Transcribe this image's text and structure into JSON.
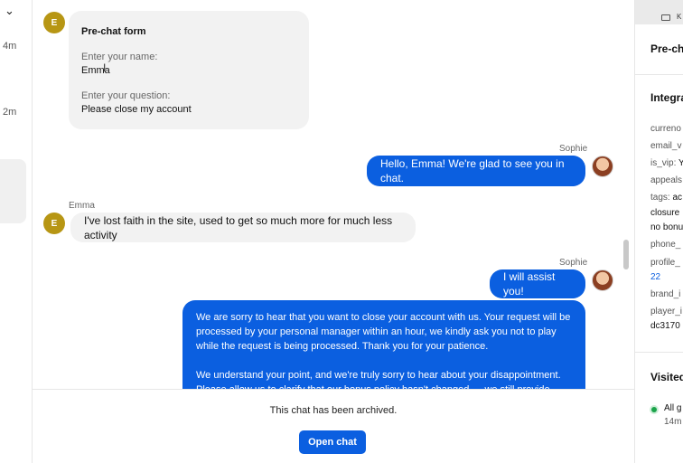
{
  "chat_list": {
    "times": [
      "4m",
      "2m"
    ]
  },
  "prechat_form": {
    "title": "Pre-chat form",
    "name_label": "Enter your name:",
    "name_value": "Emma",
    "question_label": "Enter your question:",
    "question_value": "Please close my account"
  },
  "messages": [
    {
      "author": "Sophie",
      "text": "Hello, Emma! We're glad to see you in chat.",
      "direction": "out"
    },
    {
      "author": "Emma",
      "avatar": "E",
      "text": "I've lost faith in the site, used to get so much more for much less activity",
      "direction": "in"
    },
    {
      "author": "Sophie",
      "text": "I will assist you!",
      "direction": "out"
    },
    {
      "author": "Sophie",
      "direction": "out",
      "paragraph1": "We are sorry to hear that you want to close your account with us. Your request will be processed by your personal manager within an hour, we kindly ask you not to play while the request is being processed. Thank you for your patience.",
      "paragraph2": "We understand your point, and we're truly sorry to hear about your disappointment. Please allow us to clarify that our bonus policy hasn't changed — we still provide"
    }
  ],
  "first_avatar": "E",
  "archive": {
    "note": "This chat has been archived.",
    "button": "Open chat"
  },
  "details": {
    "keyboard_hint": "K",
    "prechat_section": "Pre-ch",
    "integrations_section": "Integra",
    "attributes": [
      {
        "line": "curreno"
      },
      {
        "line": "email_v"
      },
      {
        "key": "is_vip:",
        "value": "Y"
      },
      {
        "line": "appeals"
      },
      {
        "key": "tags:",
        "value": "ac"
      },
      {
        "value": "closure"
      },
      {
        "value": "no bonu"
      },
      {
        "line": "phone_"
      },
      {
        "line": "profile_"
      },
      {
        "link": "22"
      },
      {
        "line": "brand_i"
      },
      {
        "line": "player_i"
      },
      {
        "value": "dc3170"
      }
    ],
    "visited_section": "Visited",
    "visited_item": "All g",
    "visited_time": "14m"
  },
  "colors": {
    "accent": "#0b5fe0",
    "avatar_e": "#b79614",
    "incoming_bubble": "#f2f2f2",
    "online_dot": "#1aa34a"
  }
}
